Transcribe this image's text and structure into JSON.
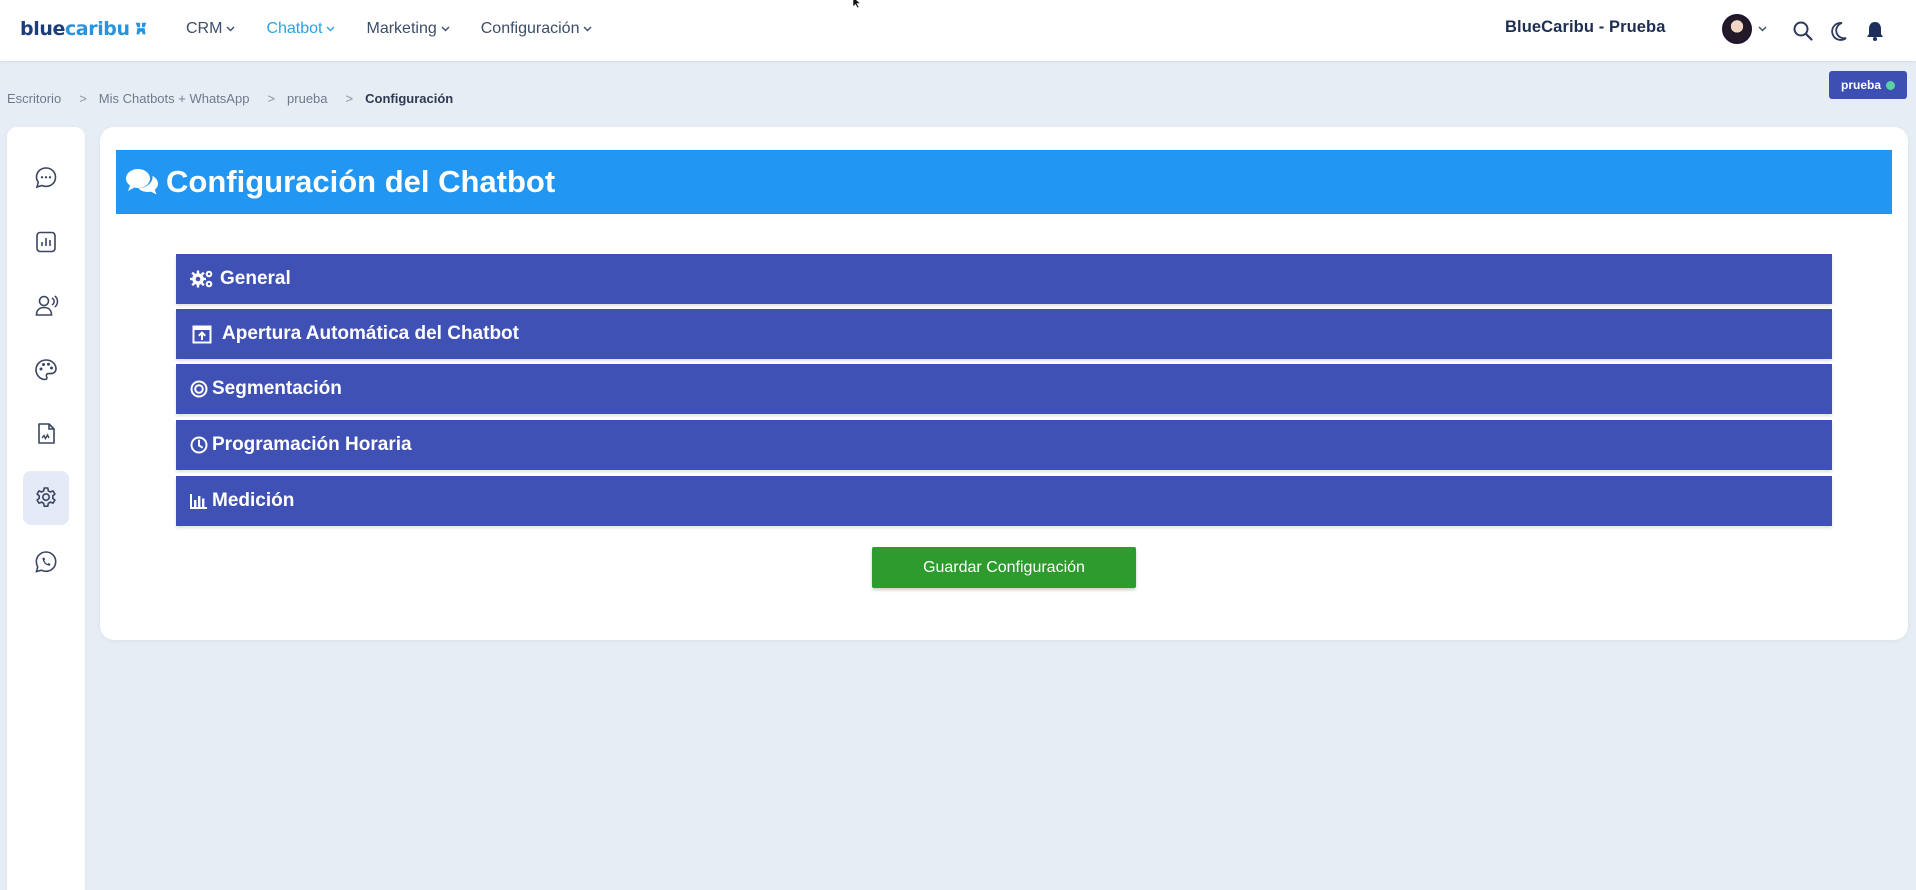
{
  "brand": {
    "part1": "blue",
    "part2": "caribu"
  },
  "nav": [
    {
      "label": "CRM"
    },
    {
      "label": "Chatbot"
    },
    {
      "label": "Marketing"
    },
    {
      "label": "Configuración"
    }
  ],
  "account": {
    "name": "BlueCaribu - Prueba"
  },
  "breadcrumb": [
    "Escritorio",
    "Mis Chatbots + WhatsApp",
    "prueba",
    "Configuración"
  ],
  "breadcrumb_separator": ">",
  "badge": {
    "label": "prueba"
  },
  "page": {
    "title": "Configuración del Chatbot"
  },
  "sections": [
    {
      "label": "General",
      "icon": "gears-icon"
    },
    {
      "label": "Apertura Automática del Chatbot",
      "icon": "window-open-icon"
    },
    {
      "label": "Segmentación",
      "icon": "target-icon"
    },
    {
      "label": "Programación Horaria",
      "icon": "clock-icon"
    },
    {
      "label": "Medición",
      "icon": "chart-icon"
    }
  ],
  "actions": {
    "save_label": "Guardar Configuración"
  },
  "sidebar": [
    {
      "icon": "chat-bubble-icon"
    },
    {
      "icon": "bar-chart-icon"
    },
    {
      "icon": "agent-icon"
    },
    {
      "icon": "palette-icon"
    },
    {
      "icon": "document-signature-icon"
    },
    {
      "icon": "settings-gear-icon",
      "active": true
    },
    {
      "icon": "whatsapp-icon"
    }
  ],
  "colors": {
    "header": "#2196f3",
    "section": "#3f51b5",
    "save_button": "#2e9b2e",
    "nav_active": "#2ba3e3"
  }
}
